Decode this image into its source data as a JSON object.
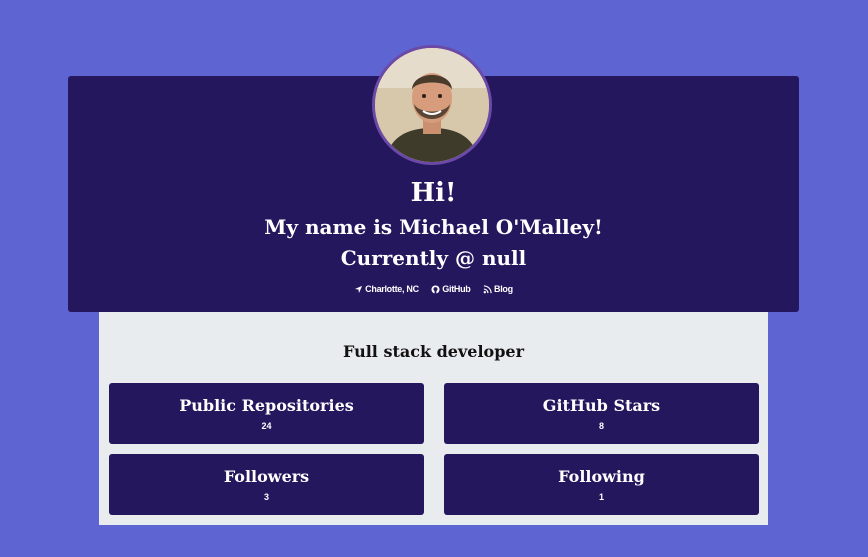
{
  "profile": {
    "greeting": "Hi!",
    "name_line": "My name is Michael O'Malley!",
    "company_line": "Currently @ null",
    "links": [
      {
        "label": "Charlotte, NC",
        "icon": "location-arrow-icon"
      },
      {
        "label": "GitHub",
        "icon": "github-icon"
      },
      {
        "label": "Blog",
        "icon": "rss-icon"
      }
    ],
    "tagline": "Full stack developer"
  },
  "stats": [
    {
      "title": "Public Repositories",
      "value": "24"
    },
    {
      "title": "GitHub Stars",
      "value": "8"
    },
    {
      "title": "Followers",
      "value": "3"
    },
    {
      "title": "Following",
      "value": "1"
    }
  ],
  "colors": {
    "page_background": "#5e65d3",
    "card_background": "#24175e",
    "content_background": "#e9ecef",
    "avatar_border": "#6b4aa7"
  }
}
